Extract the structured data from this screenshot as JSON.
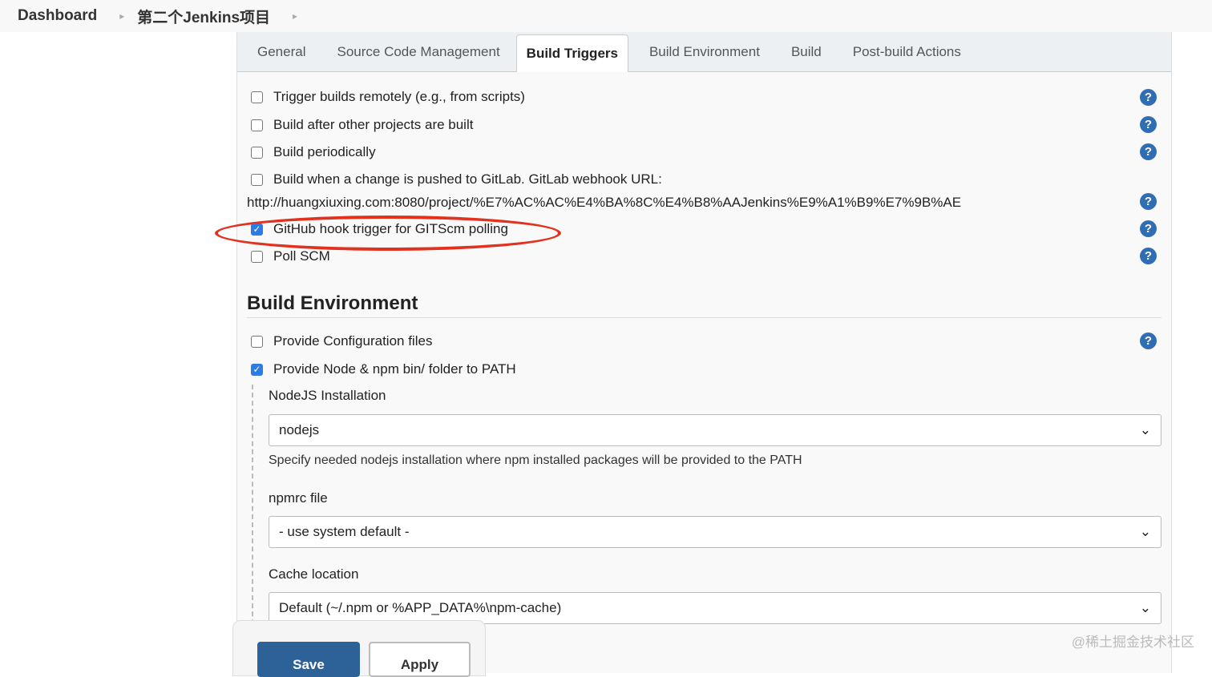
{
  "breadcrumb": {
    "items": [
      "Dashboard",
      "第二个Jenkins项目"
    ]
  },
  "tabs": [
    "General",
    "Source Code Management",
    "Build Triggers",
    "Build Environment",
    "Build",
    "Post-build Actions"
  ],
  "active_tab": "Build Triggers",
  "triggers": [
    {
      "label": "Trigger builds remotely (e.g., from scripts)",
      "checked": false
    },
    {
      "label": "Build after other projects are built",
      "checked": false
    },
    {
      "label": "Build periodically",
      "checked": false
    },
    {
      "label": "Build when a change is pushed to GitLab. GitLab webhook URL:",
      "checked": false
    },
    {
      "label": "GitHub hook trigger for GITScm polling",
      "checked": true
    },
    {
      "label": "Poll SCM",
      "checked": false
    }
  ],
  "gitlab_url": "http://huangxiuxing.com:8080/project/%E7%AC%AC%E4%BA%8C%E4%B8%AAJenkins%E9%A1%B9%E7%9B%AE",
  "build_env": {
    "title": "Build Environment",
    "options": [
      {
        "label": "Provide Configuration files",
        "checked": false
      },
      {
        "label": "Provide Node & npm bin/ folder to PATH",
        "checked": true
      }
    ],
    "nodejs_label": "NodeJS Installation",
    "nodejs_value": "nodejs",
    "nodejs_desc": "Specify needed nodejs installation where npm installed packages will be provided to the PATH",
    "npmrc_label": "npmrc file",
    "npmrc_value": "- use system default -",
    "cache_label": "Cache location",
    "cache_value": "Default (~/.npm or %APP_DATA%\\npm-cache)"
  },
  "buttons": {
    "save": "Save",
    "apply": "Apply"
  },
  "help_glyph": "?",
  "check_glyph": "✓",
  "watermark": "@稀土掘金技术社区",
  "annotation_color": "#e0321f"
}
